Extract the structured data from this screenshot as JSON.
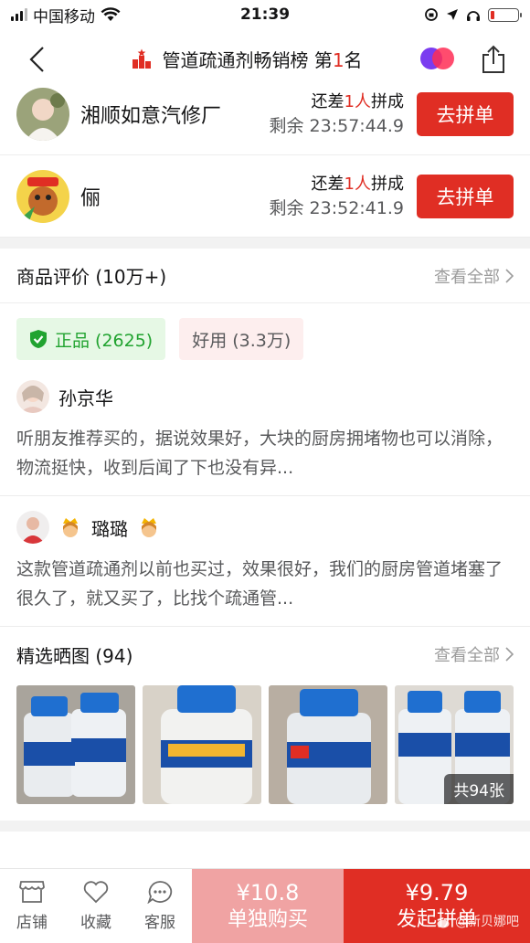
{
  "status": {
    "carrier": "中国移动",
    "time": "21:39"
  },
  "nav": {
    "title_prefix": "管道疏通剂畅销榜 第",
    "rank": "1",
    "title_suffix": "名"
  },
  "groups": [
    {
      "name": "湘顺如意汽修厂",
      "need_prefix": "还差",
      "need_count": "1人",
      "need_suffix": "拼成",
      "timer": "剩余 23:57:44.9",
      "button": "去拼单"
    },
    {
      "name": "俪",
      "need_prefix": "还差",
      "need_count": "1人",
      "need_suffix": "拼成",
      "timer": "剩余 23:52:41.9",
      "button": "去拼单"
    }
  ],
  "reviews_section": {
    "title": "商品评价 (10万+)",
    "see_all": "查看全部",
    "tags": [
      {
        "label": "正品 (2625)",
        "color": "#21a330"
      },
      {
        "label": "好用 (3.3万)"
      }
    ],
    "items": [
      {
        "name": "孙京华",
        "text": "听朋友推荐买的，据说效果好，大块的厨房拥堵物也可以消除，物流挺快，收到后闻了下也没有异..."
      },
      {
        "name": "璐璐",
        "text": "这款管道疏通剂以前也买过，效果很好，我们的厨房管道堵塞了很久了，就又买了，比找个疏通管..."
      }
    ]
  },
  "photos_section": {
    "title": "精选晒图 (94)",
    "see_all": "查看全部",
    "count_badge": "共94张"
  },
  "bottom_bar": {
    "store": "店铺",
    "favorite": "收藏",
    "service": "客服",
    "solo_price": "¥10.8",
    "solo_label": "单独购买",
    "group_price": "¥9.79",
    "group_label": "发起拼单",
    "watermark": "@新贝娜吧"
  },
  "colors": {
    "brand_red": "#e02e24",
    "solo_pink": "#f0a3a3",
    "genuine_green": "#21a330"
  }
}
